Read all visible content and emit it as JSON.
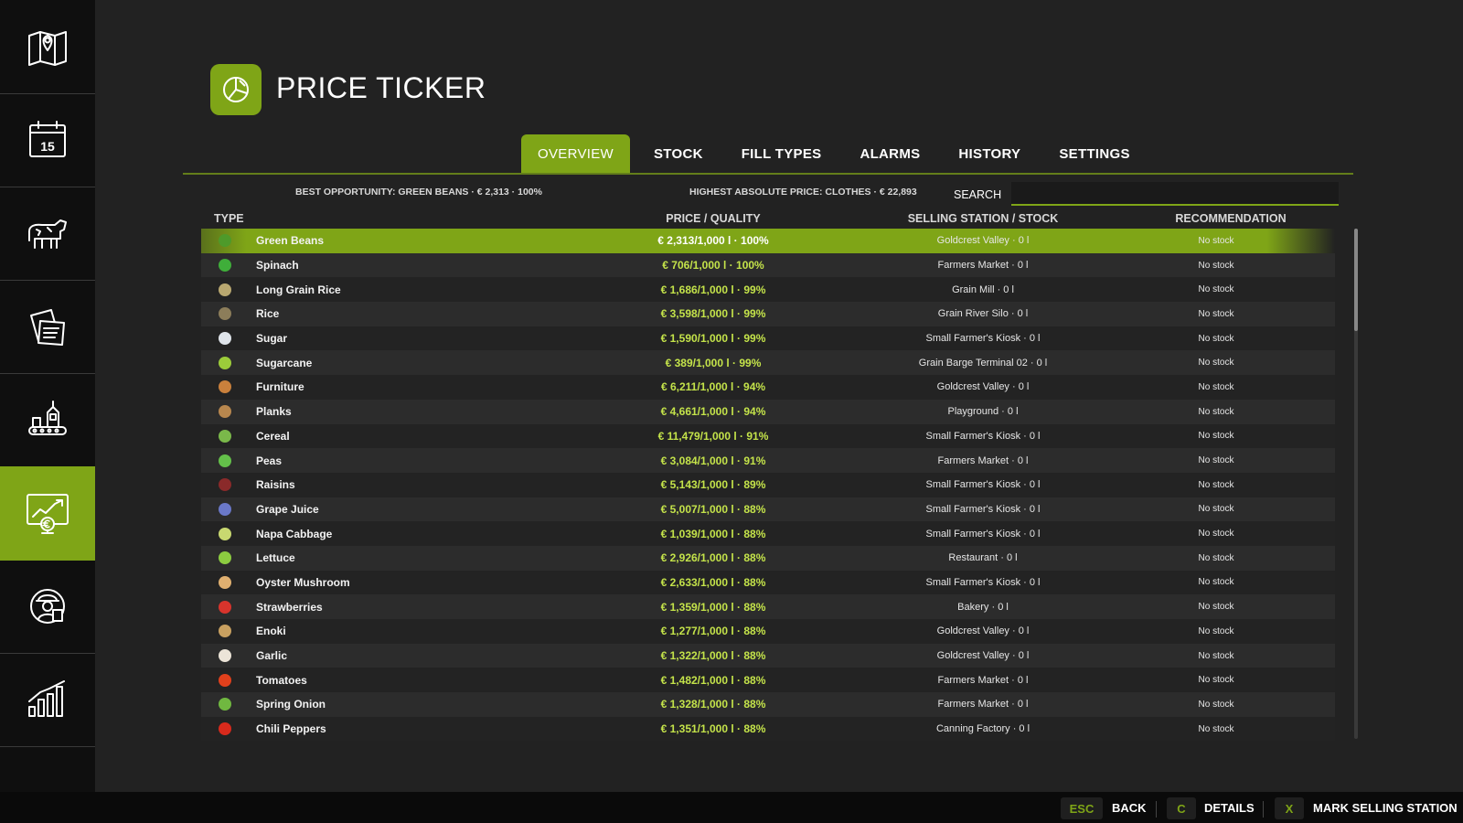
{
  "header": {
    "title": "PRICE TICKER",
    "logo_icon": "pie-chart-icon"
  },
  "sidebar": {
    "items": [
      {
        "name": "map",
        "icon": "map-icon",
        "active": false
      },
      {
        "name": "calendar",
        "icon": "calendar-icon",
        "active": false,
        "calendar_day": "15"
      },
      {
        "name": "animals",
        "icon": "cow-icon",
        "active": false
      },
      {
        "name": "contracts",
        "icon": "documents-icon",
        "active": false
      },
      {
        "name": "production",
        "icon": "factory-icon",
        "active": false
      },
      {
        "name": "price-ticker",
        "icon": "chart-monitor-icon",
        "active": true
      },
      {
        "name": "workers",
        "icon": "worker-icon",
        "active": false
      },
      {
        "name": "statistics",
        "icon": "bar-chart-icon",
        "active": false
      },
      {
        "name": "more",
        "icon": "grass-icon",
        "active": false
      }
    ]
  },
  "tabs": [
    {
      "label": "OVERVIEW",
      "active": true
    },
    {
      "label": "STOCK",
      "active": false
    },
    {
      "label": "FILL TYPES",
      "active": false
    },
    {
      "label": "ALARMS",
      "active": false
    },
    {
      "label": "HISTORY",
      "active": false
    },
    {
      "label": "SETTINGS",
      "active": false
    }
  ],
  "info": {
    "best_opportunity": "BEST OPPORTUNITY: GREEN BEANS · € 2,313 · 100%",
    "highest_price": "HIGHEST ABSOLUTE PRICE: CLOTHES · € 22,893"
  },
  "search": {
    "label": "SEARCH",
    "value": "",
    "placeholder": ""
  },
  "table": {
    "headers": {
      "type": "TYPE",
      "price": "PRICE / QUALITY",
      "station": "SELLING STATION / STOCK",
      "recommendation": "RECOMMENDATION"
    },
    "rows": [
      {
        "name": "Green Beans",
        "price": "€ 2,313/1,000 l · 100%",
        "station": "Goldcrest Valley · 0 l",
        "recommendation": "No stock",
        "icon": "green-beans-icon",
        "color": "#4e9a2a"
      },
      {
        "name": "Spinach",
        "price": "€ 706/1,000 l · 100%",
        "station": "Farmers Market · 0 l",
        "recommendation": "No stock",
        "icon": "spinach-icon",
        "color": "#3fae3a"
      },
      {
        "name": "Long Grain Rice",
        "price": "€ 1,686/1,000 l · 99%",
        "station": "Grain Mill · 0 l",
        "recommendation": "No stock",
        "icon": "rice-icon",
        "color": "#b9a870"
      },
      {
        "name": "Rice",
        "price": "€ 3,598/1,000 l · 99%",
        "station": "Grain River Silo · 0 l",
        "recommendation": "No stock",
        "icon": "rice-icon",
        "color": "#8c7d5a"
      },
      {
        "name": "Sugar",
        "price": "€ 1,590/1,000 l · 99%",
        "station": "Small Farmer's Kiosk · 0 l",
        "recommendation": "No stock",
        "icon": "sugar-icon",
        "color": "#dfe4ea"
      },
      {
        "name": "Sugarcane",
        "price": "€ 389/1,000 l · 99%",
        "station": "Grain Barge Terminal 02 · 0 l",
        "recommendation": "No stock",
        "icon": "sugarcane-icon",
        "color": "#9ccc3a"
      },
      {
        "name": "Furniture",
        "price": "€ 6,211/1,000 l · 94%",
        "station": "Goldcrest Valley · 0 l",
        "recommendation": "No stock",
        "icon": "furniture-icon",
        "color": "#c9803c"
      },
      {
        "name": "Planks",
        "price": "€ 4,661/1,000 l · 94%",
        "station": "Playground · 0 l",
        "recommendation": "No stock",
        "icon": "planks-icon",
        "color": "#b8874e"
      },
      {
        "name": "Cereal",
        "price": "€ 11,479/1,000 l · 91%",
        "station": "Small Farmer's Kiosk · 0 l",
        "recommendation": "No stock",
        "icon": "cereal-icon",
        "color": "#7ab84a"
      },
      {
        "name": "Peas",
        "price": "€ 3,084/1,000 l · 91%",
        "station": "Farmers Market · 0 l",
        "recommendation": "No stock",
        "icon": "peas-icon",
        "color": "#64c04a"
      },
      {
        "name": "Raisins",
        "price": "€ 5,143/1,000 l · 89%",
        "station": "Small Farmer's Kiosk · 0 l",
        "recommendation": "No stock",
        "icon": "raisins-icon",
        "color": "#8a2a2a"
      },
      {
        "name": "Grape Juice",
        "price": "€ 5,007/1,000 l · 88%",
        "station": "Small Farmer's Kiosk · 0 l",
        "recommendation": "No stock",
        "icon": "grape-juice-icon",
        "color": "#6a78c8"
      },
      {
        "name": "Napa Cabbage",
        "price": "€ 1,039/1,000 l · 88%",
        "station": "Small Farmer's Kiosk · 0 l",
        "recommendation": "No stock",
        "icon": "napa-cabbage-icon",
        "color": "#c8d870"
      },
      {
        "name": "Lettuce",
        "price": "€ 2,926/1,000 l · 88%",
        "station": "Restaurant · 0 l",
        "recommendation": "No stock",
        "icon": "lettuce-icon",
        "color": "#8ccc40"
      },
      {
        "name": "Oyster Mushroom",
        "price": "€ 2,633/1,000 l · 88%",
        "station": "Small Farmer's Kiosk · 0 l",
        "recommendation": "No stock",
        "icon": "mushroom-icon",
        "color": "#e0b070"
      },
      {
        "name": "Strawberries",
        "price": "€ 1,359/1,000 l · 88%",
        "station": "Bakery · 0 l",
        "recommendation": "No stock",
        "icon": "strawberry-icon",
        "color": "#d8342c"
      },
      {
        "name": "Enoki",
        "price": "€ 1,277/1,000 l · 88%",
        "station": "Goldcrest Valley · 0 l",
        "recommendation": "No stock",
        "icon": "enoki-icon",
        "color": "#c8a060"
      },
      {
        "name": "Garlic",
        "price": "€ 1,322/1,000 l · 88%",
        "station": "Goldcrest Valley · 0 l",
        "recommendation": "No stock",
        "icon": "garlic-icon",
        "color": "#ece4d8"
      },
      {
        "name": "Tomatoes",
        "price": "€ 1,482/1,000 l · 88%",
        "station": "Farmers Market · 0 l",
        "recommendation": "No stock",
        "icon": "tomato-icon",
        "color": "#e0401c"
      },
      {
        "name": "Spring Onion",
        "price": "€ 1,328/1,000 l · 88%",
        "station": "Farmers Market · 0 l",
        "recommendation": "No stock",
        "icon": "spring-onion-icon",
        "color": "#70b840"
      },
      {
        "name": "Chili Peppers",
        "price": "€ 1,351/1,000 l · 88%",
        "station": "Canning Factory · 0 l",
        "recommendation": "No stock",
        "icon": "chili-icon",
        "color": "#d82a1c"
      }
    ]
  },
  "footer": {
    "actions": [
      {
        "key": "ESC",
        "label": "BACK"
      },
      {
        "key": "C",
        "label": "DETAILS"
      },
      {
        "key": "X",
        "label": "MARK SELLING STATION"
      }
    ]
  },
  "colors": {
    "accent": "#7fa517",
    "price": "#c4e34a",
    "background": "#222222",
    "sidebar": "#0f0f0f"
  }
}
